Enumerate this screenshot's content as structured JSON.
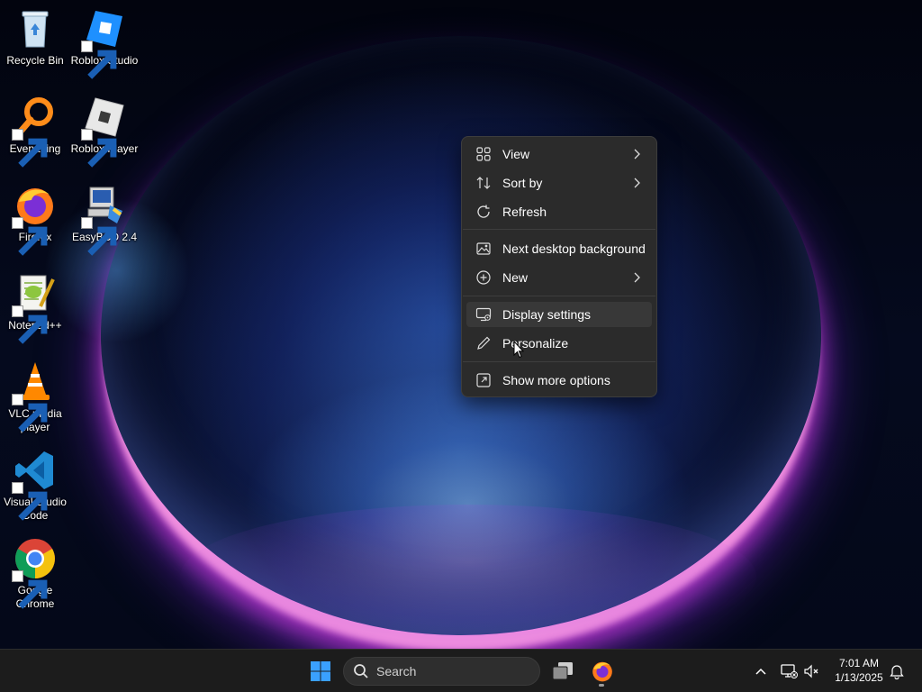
{
  "desktop": {
    "icons": [
      {
        "label": "Recycle Bin",
        "icon": "recycle-bin-icon"
      },
      {
        "label": "Roblox Studio",
        "icon": "roblox-studio-icon"
      },
      {
        "label": "Everything",
        "icon": "everything-search-icon"
      },
      {
        "label": "Roblox Player",
        "icon": "roblox-player-icon"
      },
      {
        "label": "Firefox",
        "icon": "firefox-icon"
      },
      {
        "label": "EasyBCD 2.4",
        "icon": "easybcd-icon"
      },
      {
        "label": "Notepad++",
        "icon": "notepad-plus-plus-icon"
      },
      {
        "label_line1": "VLC media",
        "label_line2": "player",
        "icon": "vlc-icon"
      },
      {
        "label_line1": "Visual Studio",
        "label_line2": "Code",
        "icon": "vscode-icon"
      },
      {
        "label_line1": "Google",
        "label_line2": "Chrome",
        "icon": "chrome-icon"
      }
    ]
  },
  "context_menu": {
    "items": [
      {
        "label": "View",
        "icon": "view-grid-icon",
        "submenu": true
      },
      {
        "label": "Sort by",
        "icon": "sort-icon",
        "submenu": true
      },
      {
        "label": "Refresh",
        "icon": "refresh-icon",
        "submenu": false
      },
      {
        "label": "Next desktop background",
        "icon": "next-background-icon",
        "submenu": false
      },
      {
        "label": "New",
        "icon": "new-plus-icon",
        "submenu": true
      },
      {
        "label": "Display settings",
        "icon": "display-settings-icon",
        "submenu": false,
        "highlighted": true
      },
      {
        "label": "Personalize",
        "icon": "pen-icon",
        "submenu": false
      },
      {
        "label": "Show more options",
        "icon": "show-more-options-icon",
        "submenu": false
      }
    ]
  },
  "taskbar": {
    "search_placeholder": "Search",
    "pinned": [
      "start-button",
      "search-box",
      "task-view",
      "firefox"
    ],
    "tray": {
      "time": "7:01 AM",
      "date": "1/13/2025"
    }
  },
  "colors": {
    "menu_bg": "#2b2b2b",
    "menu_hover": "#383838",
    "taskbar_bg": "#1c1c1c",
    "start_blue": "#3aa0ff"
  }
}
